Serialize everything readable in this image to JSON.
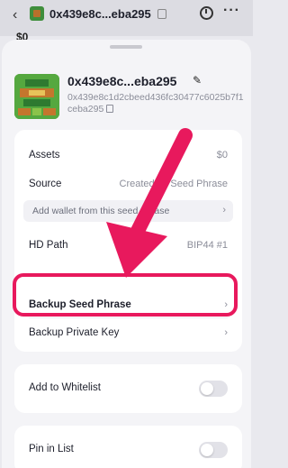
{
  "topbar": {
    "back_icon": "chevron-left-icon",
    "address": "0x439e8c...eba295",
    "peek_text": "$0"
  },
  "account": {
    "short_address": "0x439e8c...eba295",
    "full_address": "0x439e8c1d2cbeed436fc30477c6025b7f1ceba295"
  },
  "info": {
    "assets_label": "Assets",
    "assets_value": "$0",
    "source_label": "Source",
    "source_value": "Created by Seed Phrase",
    "add_wallet_text": "Add wallet from this seed phrase",
    "hdpath_label": "HD Path",
    "hdpath_value": "BIP44 #1"
  },
  "backup": {
    "seed_label": "Backup Seed Phrase",
    "key_label": "Backup Private Key"
  },
  "whitelist": {
    "label": "Add to Whitelist",
    "enabled": false
  },
  "pin": {
    "label": "Pin in List",
    "enabled": false
  },
  "colors": {
    "highlight": "#e8195d",
    "arrow": "#e8195d",
    "avatar_green": "#4c9a3b"
  }
}
